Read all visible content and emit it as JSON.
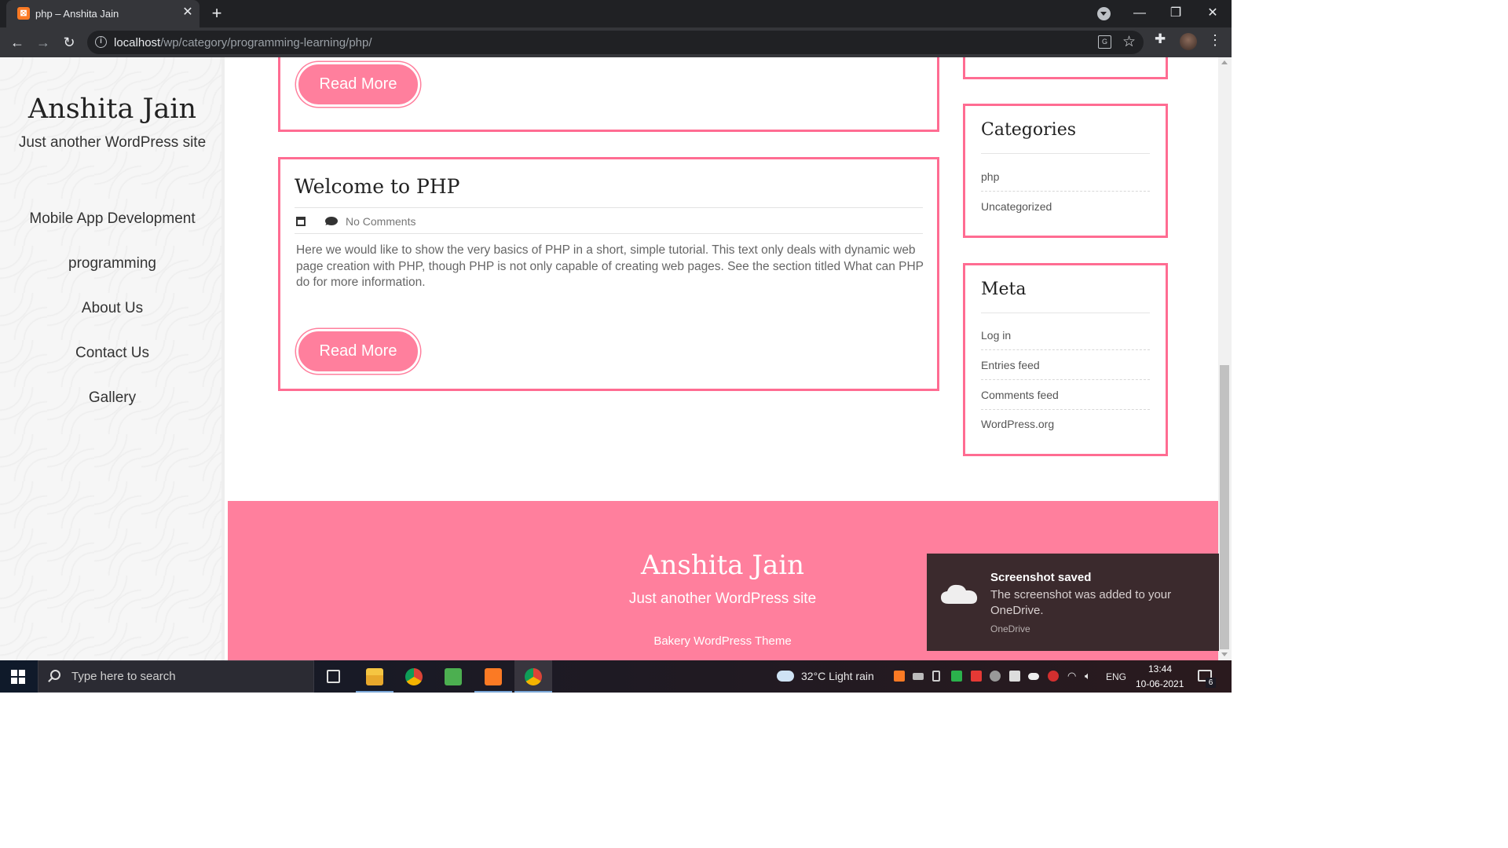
{
  "browser": {
    "tab_title": "php – Anshita Jain",
    "tab_favicon": "xampp-icon",
    "url_host": "localhost",
    "url_path": "/wp/category/programming-learning/php/"
  },
  "site": {
    "title": "Anshita Jain",
    "tagline": "Just another WordPress site"
  },
  "menu": [
    {
      "label": "Mobile App Development"
    },
    {
      "label": "programming"
    },
    {
      "label": "About Us"
    },
    {
      "label": "Contact Us"
    },
    {
      "label": "Gallery"
    }
  ],
  "posts": {
    "prev_read_more": "Read More",
    "current": {
      "title": "Welcome to PHP",
      "comments": "No Comments",
      "excerpt": "Here we would like to show the very basics of PHP in a short, simple tutorial. This text only deals with dynamic web page creation with PHP, though PHP is not only capable of creating web pages. See the section titled What can PHP do for more information.",
      "read_more": "Read More"
    }
  },
  "widgets": {
    "categories": {
      "title": "Categories",
      "items": [
        "php",
        "Uncategorized"
      ]
    },
    "meta": {
      "title": "Meta",
      "items": [
        "Log in",
        "Entries feed",
        "Comments feed",
        "WordPress.org"
      ]
    }
  },
  "footer": {
    "title": "Anshita Jain",
    "tagline": "Just another WordPress site",
    "credit": "Bakery WordPress Theme"
  },
  "toast": {
    "title": "Screenshot saved",
    "body": "The screenshot was added to your OneDrive.",
    "source": "OneDrive"
  },
  "taskbar": {
    "search_placeholder": "Type here to search",
    "weather": "32°C  Light rain",
    "language": "ENG",
    "time": "13:44",
    "date": "10-06-2021",
    "notification_count": "6"
  },
  "colors": {
    "accent_pink": "#ff7f9d",
    "border_pink": "#ff6c92"
  }
}
